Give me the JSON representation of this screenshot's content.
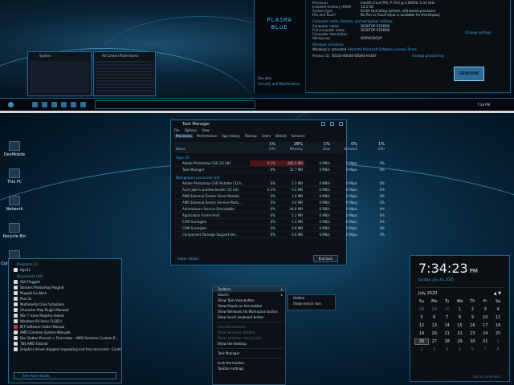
{
  "top": {
    "system_panel": {
      "logo_line1": "PLASMA",
      "logo_line2": "BLUE",
      "info_rows": [
        {
          "label": "Processor",
          "value": "Intel(R) Core(TM) i7 CPU @ 2.80GHz  3.34 GHz"
        },
        {
          "label": "Installed memory (RAM)",
          "value": "12.0 GB"
        },
        {
          "label": "System type",
          "value": "64-bit Operating System, x64-based processor"
        },
        {
          "label": "Pen and Touch",
          "value": "No Pen or Touch Input is available for this Display"
        }
      ],
      "section_computer": "Computer name, domain, and workgroup settings",
      "computer_rows": [
        {
          "label": "Computer name",
          "value": "DESKTOP-E1R6M6"
        },
        {
          "label": "Full computer name",
          "value": "DESKTOP-E1R6M6"
        },
        {
          "label": "Computer description",
          "value": ""
        },
        {
          "label": "Workgroup",
          "value": "WORKGROUP"
        }
      ],
      "change_settings": "Change settings",
      "section_activation": "Windows activation",
      "activation_text": "Windows is activated",
      "license_link": "Read the Microsoft Software License Terms",
      "product_id_label": "Product ID:",
      "product_id": "00330-80000-00000-AA387",
      "change_product_key": "Change product key",
      "see_also": "See also",
      "security_link": "Security and Maintenance",
      "genuine_badge": "GENUINE"
    },
    "mini_window_left_title": "System",
    "mini_window_right_title": "All Control Panel Items",
    "taskbar_clock": "7:34 PM"
  },
  "desktop_icons": [
    "DevMobile",
    "This PC",
    "Network",
    "Recycle Bin",
    "Control Panel"
  ],
  "task_manager": {
    "title": "Task Manager",
    "menu": [
      "File",
      "Options",
      "View"
    ],
    "tabs": [
      "Processes",
      "Performance",
      "App history",
      "Startup",
      "Users",
      "Details",
      "Services"
    ],
    "columns": [
      "Name",
      "CPU",
      "Memory",
      "Disk",
      "Network",
      "GPU"
    ],
    "column_percents": [
      "1%",
      "28%",
      "1%",
      "0%",
      "1%"
    ],
    "section_apps": "Apps (2)",
    "section_bg": "Background processes (14)",
    "apps": [
      {
        "name": "Adobe Photoshop CS6 (32 bit)",
        "cpu": "0.1%",
        "mem": "885.5 MB",
        "disk": "0 MB/s",
        "net": "0 Mbps",
        "gpu": "0%",
        "highlight": true
      },
      {
        "name": "Task Manager",
        "cpu": "0%",
        "mem": "12.7 MB",
        "disk": "0 MB/s",
        "net": "0 Mbps",
        "gpu": "0%",
        "highlight": false
      }
    ],
    "background": [
      {
        "name": "Adobe Photoshop CS6 Portable (32 b...",
        "cpu": "0%",
        "mem": "2.1 MB",
        "disk": "0 MB/s",
        "net": "0 Mbps",
        "gpu": "0%"
      },
      {
        "name": "Anon Jake's window border (32 bit)",
        "cpu": "0.1%",
        "mem": "0.2 MB",
        "disk": "0 MB/s",
        "net": "0 Mbps",
        "gpu": "0%"
      },
      {
        "name": "AMD External Events Client Module",
        "cpu": "0%",
        "mem": "1.6 MB",
        "disk": "0 MB/s",
        "net": "0 Mbps",
        "gpu": "0%"
      },
      {
        "name": "AMD External Events Service Modu...",
        "cpu": "0%",
        "mem": "0.6 MB",
        "disk": "0 MB/s",
        "net": "0 Mbps",
        "gpu": "0%"
      },
      {
        "name": "Antimalware Service Executable",
        "cpu": "0%",
        "mem": "44.8 MB",
        "disk": "0 MB/s",
        "net": "0 Mbps",
        "gpu": "0%"
      },
      {
        "name": "Application Frame Host",
        "cpu": "0%",
        "mem": "5.2 MB",
        "disk": "0 MB/s",
        "net": "0 Mbps",
        "gpu": "0%"
      },
      {
        "name": "COM Surrogate",
        "cpu": "0%",
        "mem": "1.3 MB",
        "disk": "0 MB/s",
        "net": "0 Mbps",
        "gpu": "0%"
      },
      {
        "name": "COM Surrogate",
        "cpu": "0%",
        "mem": "0.8 MB",
        "disk": "0 MB/s",
        "net": "0 Mbps",
        "gpu": "0%"
      },
      {
        "name": "Component Package Support Ser...",
        "cpu": "0%",
        "mem": "0.6 MB",
        "disk": "0 MB/s",
        "net": "0 Mbps",
        "gpu": "0%"
      }
    ],
    "fewer_details": "Fewer details",
    "end_task": "End task"
  },
  "context_menu": {
    "items": [
      {
        "label": "Toolbars",
        "dim": false,
        "sel": true,
        "arrow": true
      },
      {
        "label": "Search",
        "dim": false,
        "sel": false,
        "arrow": true
      },
      {
        "label": "Show Task View button",
        "dim": false,
        "sel": false,
        "arrow": false
      },
      {
        "label": "Show People on the taskbar",
        "dim": false,
        "sel": false,
        "arrow": false
      },
      {
        "label": "Show Windows Ink Workspace button",
        "dim": false,
        "sel": false,
        "arrow": false
      },
      {
        "label": "Show touch keyboard button",
        "dim": false,
        "sel": false,
        "arrow": false
      },
      {
        "label": "",
        "dim": true,
        "sel": false,
        "arrow": false
      },
      {
        "label": "Cascade windows",
        "dim": true,
        "sel": false,
        "arrow": false
      },
      {
        "label": "Show windows stacked",
        "dim": true,
        "sel": false,
        "arrow": false
      },
      {
        "label": "Show windows side by side",
        "dim": true,
        "sel": false,
        "arrow": false
      },
      {
        "label": "Show the desktop",
        "dim": false,
        "sel": false,
        "arrow": false
      },
      {
        "label": "",
        "dim": true,
        "sel": false,
        "arrow": false
      },
      {
        "label": "Task Manager",
        "dim": false,
        "sel": false,
        "arrow": false
      },
      {
        "label": "",
        "dim": true,
        "sel": false,
        "arrow": false
      },
      {
        "label": "Lock the taskbar",
        "dim": false,
        "sel": false,
        "arrow": false
      },
      {
        "label": "Taskbar settings",
        "dim": false,
        "sel": false,
        "arrow": false
      }
    ],
    "submenu": [
      "Hidden",
      "Show search icon"
    ]
  },
  "start_menu": {
    "programs_header": "Programs (1)",
    "program": "Hgv01",
    "documents_header": "Documents (19)",
    "documents": [
      "Still Flagged",
      "Stickers Photoshop Plugin8",
      "Plugin8 Go Work",
      "Plus 3x",
      "Multimedia Class Scheduler",
      "Character Map Plugin Manuals",
      "Win 7 Icons Registry Values",
      "Windows 64 Icons CLSID's",
      "IDT Software Folder Manual",
      "AMD Common System Manuals",
      "Blur Button Percent + Fine Index - AMD Ouromos Custom B...",
      "TBS AMD Tutorial",
      "Graphics driver stopped responding and has recovered - Customi..."
    ],
    "see_more": "See more results",
    "search_placeholder": ""
  },
  "calendar": {
    "time": "7:34:23",
    "ampm": "PM",
    "date": "Sunday, July 26, 2020",
    "month": "July 2020",
    "weekdays": [
      "Su",
      "Mo",
      "Tu",
      "We",
      "Th",
      "Fr",
      "Sa"
    ],
    "days": [
      [
        "28",
        "29",
        "30",
        "1",
        "2",
        "3",
        "4"
      ],
      [
        "5",
        "6",
        "7",
        "8",
        "9",
        "10",
        "11"
      ],
      [
        "12",
        "13",
        "14",
        "15",
        "16",
        "17",
        "18"
      ],
      [
        "19",
        "20",
        "21",
        "22",
        "23",
        "24",
        "25"
      ],
      [
        "26",
        "27",
        "28",
        "29",
        "30",
        "31",
        "1"
      ],
      [
        "2",
        "3",
        "4",
        "5",
        "6",
        "7",
        "8"
      ]
    ],
    "today": "26",
    "footer": "Set up reminders"
  }
}
